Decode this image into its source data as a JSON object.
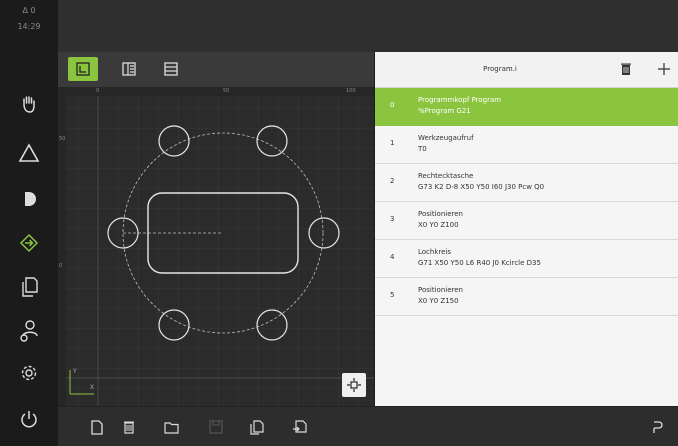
{
  "status_bar": {
    "indicator": "Δ 0",
    "time": "14:29"
  },
  "sidebar": {
    "items": [
      {
        "name": "manual-mode",
        "icon": "hand-icon"
      },
      {
        "name": "mdi-mode",
        "icon": "triangle-icon"
      },
      {
        "name": "program-run",
        "icon": "half-circle-icon"
      },
      {
        "name": "programming",
        "icon": "arrow-diamond-icon"
      },
      {
        "name": "file-management",
        "icon": "documents-icon"
      },
      {
        "name": "user-login",
        "icon": "user-gear-icon"
      },
      {
        "name": "settings",
        "icon": "gear-icon"
      },
      {
        "name": "power",
        "icon": "power-icon"
      }
    ]
  },
  "view_toolbar": {
    "buttons": [
      {
        "name": "graphic-view",
        "icon": "graphic-view-icon",
        "active": true
      },
      {
        "name": "split-view",
        "icon": "split-view-icon",
        "active": false
      },
      {
        "name": "list-view",
        "icon": "list-view-icon",
        "active": false
      }
    ]
  },
  "canvas": {
    "ruler_x_labels": [
      "0",
      "50",
      "100"
    ],
    "ruler_y_labels": [
      "50",
      "0"
    ],
    "axis_y_label": "Y",
    "axis_x_label": "X"
  },
  "program": {
    "title": "Program.i",
    "steps": [
      {
        "number": "0",
        "title": "Programmkopf Program",
        "detail": "%Program G21",
        "active": true
      },
      {
        "number": "1",
        "title": "Werkzeugaufruf",
        "detail": "T0",
        "active": false
      },
      {
        "number": "2",
        "title": "Rechtecktasche",
        "detail": "G73 K2 D-8 X50 Y50 I60 J30 Pcw Q0",
        "active": false
      },
      {
        "number": "3",
        "title": "Positionieren",
        "detail": "X0 Y0 Z100",
        "active": false
      },
      {
        "number": "4",
        "title": "Lochkreis",
        "detail": "G71 X50 Y50 L6 R40 J0 Kcircle D35",
        "active": false
      },
      {
        "number": "5",
        "title": "Positionieren",
        "detail": "X0 Y0 Z150",
        "active": false
      }
    ]
  },
  "colors": {
    "accent": "#8bc53f",
    "background": "#1c1c1c",
    "list_bg": "#f5f5f5"
  }
}
